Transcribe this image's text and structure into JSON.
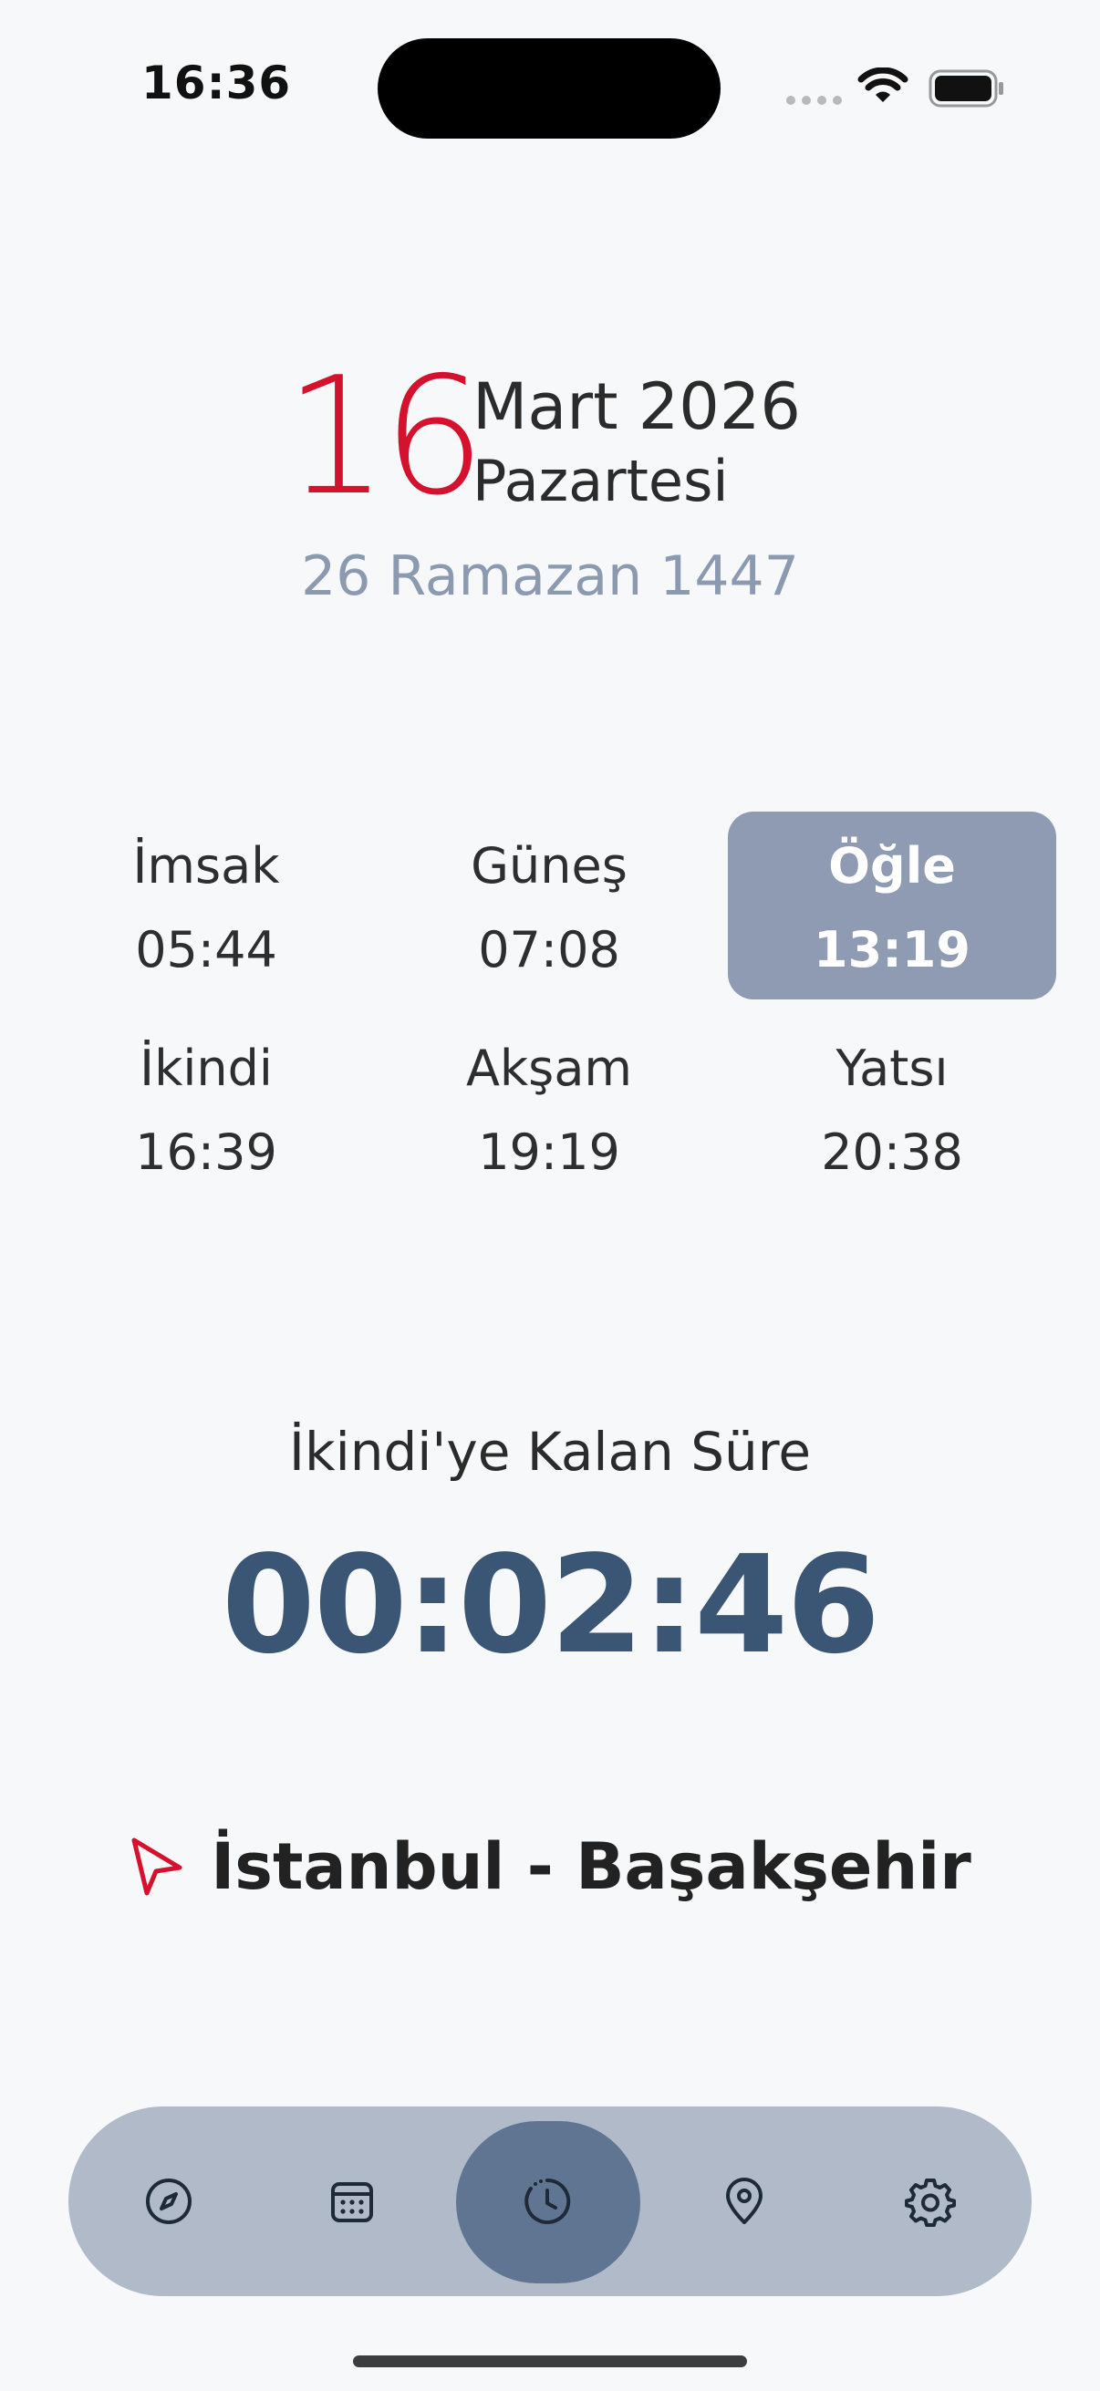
{
  "status_bar": {
    "time": "16:36"
  },
  "date": {
    "day": "16",
    "month_year": "Mart 2026",
    "weekday": "Pazartesi",
    "hijri": "26 Ramazan 1447"
  },
  "prayers": [
    {
      "name": "İmsak",
      "time": "05:44",
      "active": false
    },
    {
      "name": "Güneş",
      "time": "07:08",
      "active": false
    },
    {
      "name": "Öğle",
      "time": "13:19",
      "active": true
    },
    {
      "name": "İkindi",
      "time": "16:39",
      "active": false
    },
    {
      "name": "Akşam",
      "time": "19:19",
      "active": false
    },
    {
      "name": "Yatsı",
      "time": "20:38",
      "active": false
    }
  ],
  "countdown": {
    "label": "İkindi'ye Kalan Süre",
    "value": "00:02:46"
  },
  "location": {
    "text": "İstanbul - Başakşehir",
    "icon": "navigation-arrow-icon"
  },
  "nav": {
    "items": [
      {
        "icon": "compass-icon",
        "active": false
      },
      {
        "icon": "calendar-icon",
        "active": false
      },
      {
        "icon": "clock-icon",
        "active": true
      },
      {
        "icon": "map-pin-icon",
        "active": false
      },
      {
        "icon": "gear-icon",
        "active": false
      }
    ]
  },
  "colors": {
    "accent_red": "#d4122e",
    "countdown_blue": "#3b5574",
    "active_prayer_bg": "#8e9bb2",
    "nav_bg": "#b0bac8",
    "nav_active": "#5f7591"
  }
}
